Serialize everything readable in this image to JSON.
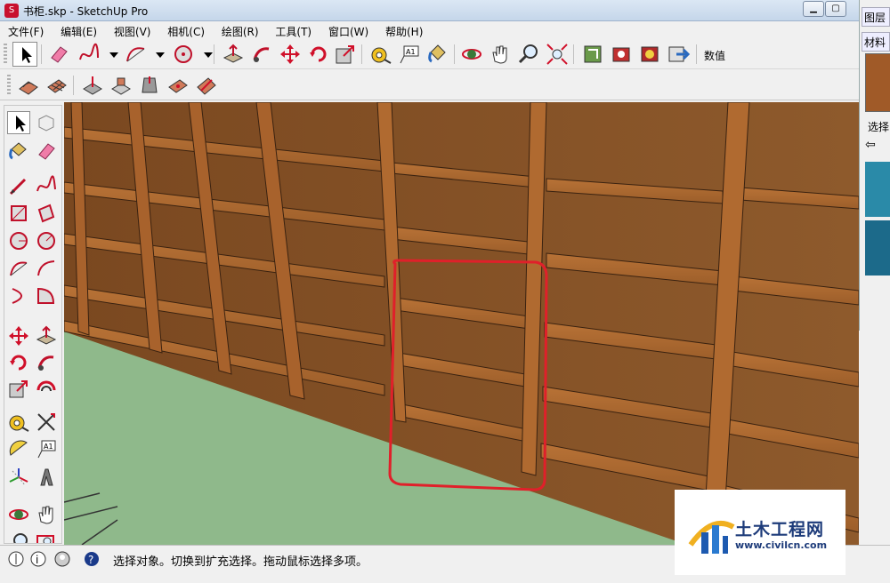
{
  "window": {
    "title": "书柜.skp - SketchUp Pro"
  },
  "menu": [
    "文件(F)",
    "编辑(E)",
    "视图(V)",
    "相机(C)",
    "绘图(R)",
    "工具(T)",
    "窗口(W)",
    "帮助(H)"
  ],
  "toolbar": {
    "value_label": "数值"
  },
  "tray": {
    "tab_layers": "图层",
    "tab_materials": "材料",
    "select_label": "选择"
  },
  "status": {
    "text": "选择对象。切换到扩充选择。拖动鼠标选择多项。"
  },
  "watermark": {
    "title": "土木工程网",
    "url": "www.civilcn.com"
  },
  "colors": {
    "ground": "#8fb98b",
    "wood": "#a8622c",
    "highlight": "#e0202a"
  }
}
